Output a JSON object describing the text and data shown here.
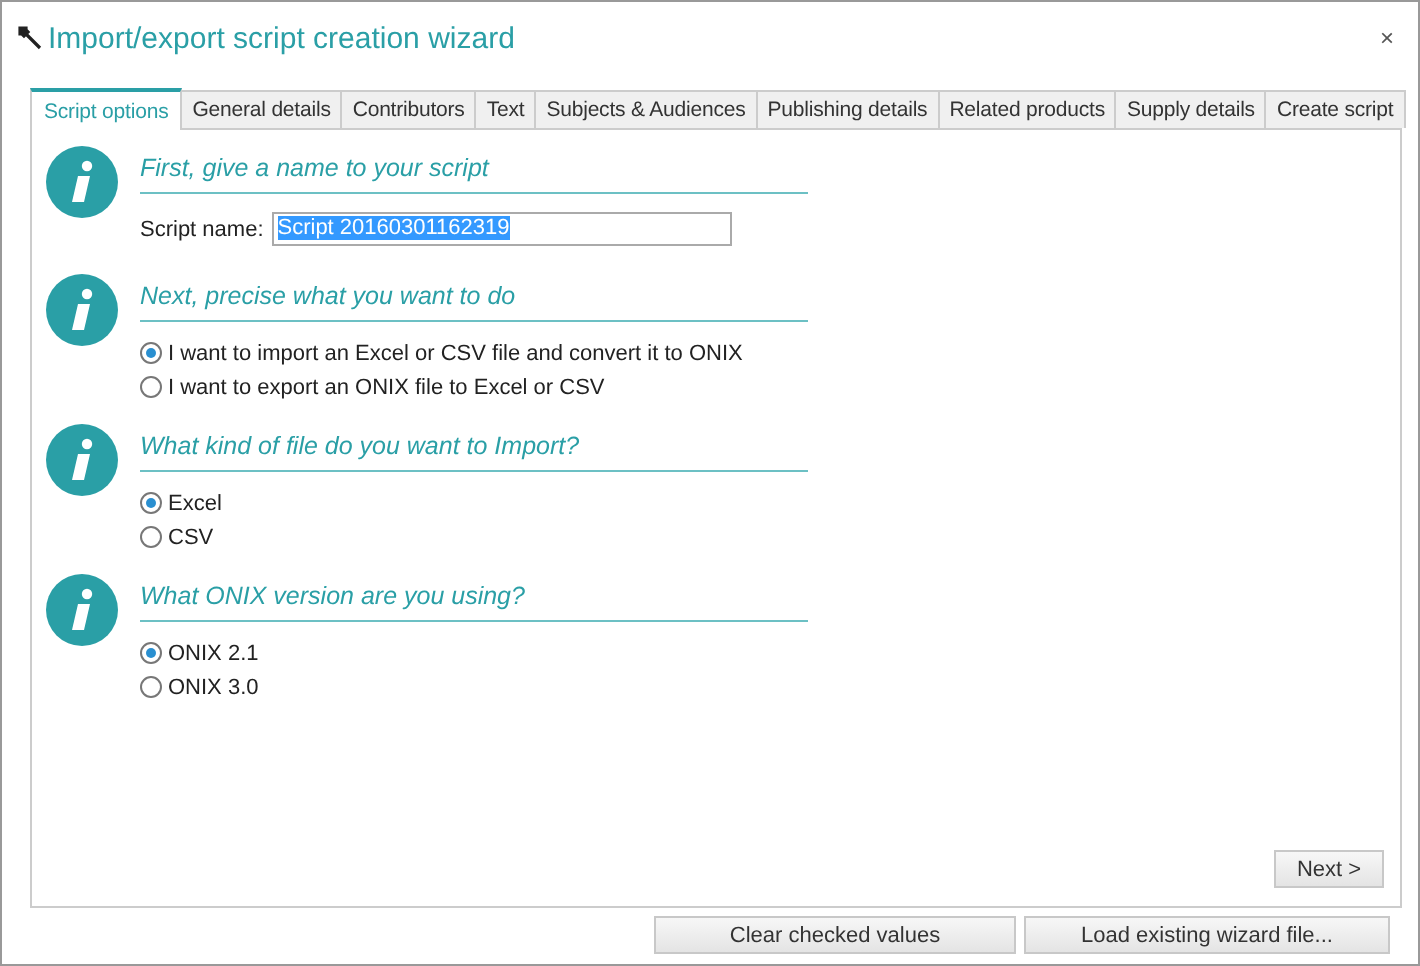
{
  "window": {
    "title": "Import/export script creation wizard",
    "close": "×"
  },
  "tabs": [
    {
      "label": "Script options",
      "selected": true
    },
    {
      "label": "General details",
      "selected": false
    },
    {
      "label": "Contributors",
      "selected": false
    },
    {
      "label": "Text",
      "selected": false
    },
    {
      "label": "Subjects & Audiences",
      "selected": false
    },
    {
      "label": "Publishing details",
      "selected": false
    },
    {
      "label": "Related products",
      "selected": false
    },
    {
      "label": "Supply details",
      "selected": false
    },
    {
      "label": "Create script",
      "selected": false
    }
  ],
  "sections": [
    {
      "kind": "field",
      "heading": "First, give a name to your script",
      "label": "Script name:",
      "value": "Script 20160301162319"
    },
    {
      "kind": "radios",
      "heading": "Next, precise what you want to do",
      "options": [
        {
          "label": "I want to import an Excel or CSV file and convert it to ONIX",
          "selected": true
        },
        {
          "label": "I want to export an ONIX file to Excel or CSV",
          "selected": false
        }
      ]
    },
    {
      "kind": "radios",
      "heading": "What kind of file do you want to Import?",
      "options": [
        {
          "label": "Excel",
          "selected": true
        },
        {
          "label": "CSV",
          "selected": false
        }
      ]
    },
    {
      "kind": "radios",
      "heading": "What ONIX version are you using?",
      "options": [
        {
          "label": "ONIX 2.1",
          "selected": true
        },
        {
          "label": "ONIX 3.0",
          "selected": false
        }
      ]
    }
  ],
  "next_button": "Next >",
  "footer_buttons": [
    "Clear checked values",
    "Load existing wizard file..."
  ]
}
